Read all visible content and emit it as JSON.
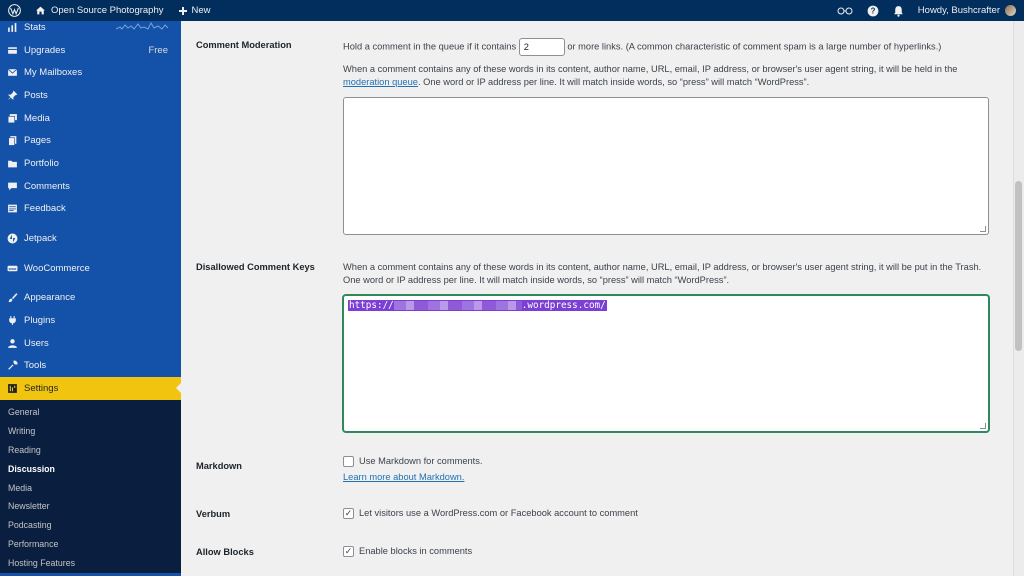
{
  "adminbar": {
    "site_name": "Open Source Photography",
    "new_label": "New",
    "howdy": "Howdy, Bushcrafter"
  },
  "sidebar": {
    "items": [
      {
        "label": "Stats",
        "icon": "stats-icon"
      },
      {
        "label": "Upgrades",
        "icon": "upgrades-icon",
        "badge": "Free"
      },
      {
        "label": "My Mailboxes",
        "icon": "mail-icon"
      },
      {
        "label": "Posts",
        "icon": "pin-icon"
      },
      {
        "label": "Media",
        "icon": "media-icon"
      },
      {
        "label": "Pages",
        "icon": "pages-icon"
      },
      {
        "label": "Portfolio",
        "icon": "portfolio-icon"
      },
      {
        "label": "Comments",
        "icon": "comments-icon"
      },
      {
        "label": "Feedback",
        "icon": "feedback-icon"
      },
      {
        "label": "Jetpack",
        "icon": "jetpack-icon"
      },
      {
        "label": "WooCommerce",
        "icon": "woo-icon"
      },
      {
        "label": "Appearance",
        "icon": "brush-icon"
      },
      {
        "label": "Plugins",
        "icon": "plugin-icon"
      },
      {
        "label": "Users",
        "icon": "users-icon"
      },
      {
        "label": "Tools",
        "icon": "tools-icon"
      },
      {
        "label": "Settings",
        "icon": "settings-icon"
      }
    ],
    "submenu": [
      "General",
      "Writing",
      "Reading",
      "Discussion",
      "Media",
      "Newsletter",
      "Podcasting",
      "Performance",
      "Hosting Features"
    ]
  },
  "moderation": {
    "label": "Comment Moderation",
    "links_prefix": "Hold a comment in the queue if it contains",
    "links_value": "2",
    "links_suffix": "or more links. (A common characteristic of comment spam is a large number of hyperlinks.)",
    "desc_1": "When a comment contains any of these words in its content, author name, URL, email, IP address, or browser's user agent string, it will be held in the",
    "desc_link": "moderation queue",
    "desc_2": ". One word or IP address per line. It will match inside words, so “press” will match “WordPress”."
  },
  "disallowed": {
    "label": "Disallowed Comment Keys",
    "desc_1": "When a comment contains any of these words in its content, author name, URL, email, IP address, or browser's user agent string, it will be put in the Trash.",
    "desc_2": "One word or IP address per line. It will match inside words, so “press” will match “WordPress”.",
    "value_prefix": "https://",
    "value_suffix": ".wordpress.com/"
  },
  "markdown": {
    "label": "Markdown",
    "checkbox": "Use Markdown for comments.",
    "link": "Learn more about Markdown."
  },
  "verbum": {
    "label": "Verbum",
    "checkbox": "Let visitors use a WordPress.com or Facebook account to comment"
  },
  "blocks": {
    "label": "Allow Blocks",
    "checkbox": "Enable blocks in comments"
  }
}
